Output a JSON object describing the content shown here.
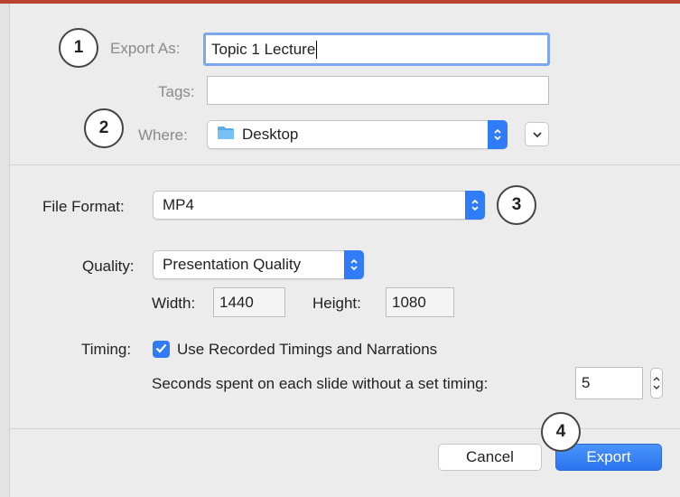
{
  "colors": {
    "accent": "#2f7cf6",
    "focus_ring": "#7aa7ee",
    "titlebar": "#b9432f"
  },
  "export_as": {
    "label": "Export As:",
    "value": "Topic 1 Lecture"
  },
  "tags": {
    "label": "Tags:",
    "value": ""
  },
  "where": {
    "label": "Where:",
    "value": "Desktop",
    "icon": "folder-icon"
  },
  "file_format": {
    "label": "File Format:",
    "value": "MP4"
  },
  "quality": {
    "label": "Quality:",
    "value": "Presentation Quality"
  },
  "dimensions": {
    "width_label": "Width:",
    "width_value": "1440",
    "height_label": "Height:",
    "height_value": "1080"
  },
  "timing": {
    "label": "Timing:",
    "checkbox_label": "Use Recorded Timings and Narrations",
    "checked": true,
    "seconds_label": "Seconds spent on each slide without a set timing:",
    "seconds_value": "5"
  },
  "buttons": {
    "cancel": "Cancel",
    "export": "Export"
  },
  "callouts": [
    "1",
    "2",
    "3",
    "4"
  ]
}
